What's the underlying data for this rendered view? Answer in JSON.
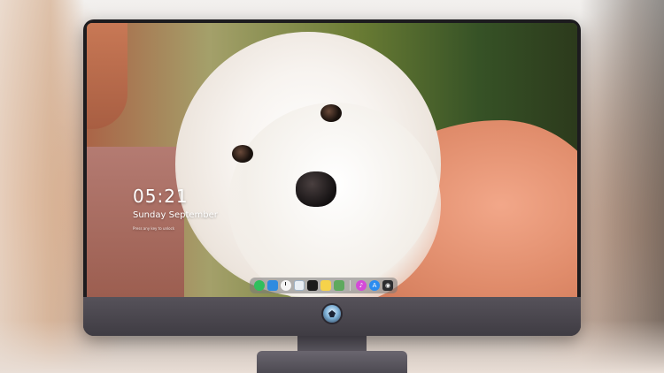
{
  "lock_screen": {
    "time": "05:21",
    "date": "Sunday September",
    "subline": "Press any key to unlock"
  },
  "dock": {
    "apps": [
      {
        "name": "finder",
        "icon": "green-circle-icon",
        "color": "#2fbf5d"
      },
      {
        "name": "files",
        "icon": "blue-folder-icon",
        "color": "#2e8be0"
      },
      {
        "name": "clock",
        "icon": "clock-icon",
        "color": "#f4f4f4"
      },
      {
        "name": "mail",
        "icon": "mail-icon",
        "color": "#e9eef3"
      },
      {
        "name": "video",
        "icon": "clapperboard-icon",
        "color": "#1b1b1b"
      },
      {
        "name": "notes",
        "icon": "notes-icon",
        "color": "#f6d24a"
      },
      {
        "name": "photos",
        "icon": "photos-icon",
        "color": "#5ea95e"
      },
      {
        "name": "music",
        "icon": "music-icon",
        "color": "#d44ad8"
      },
      {
        "name": "app-store",
        "icon": "app-store-icon",
        "color": "#2b8cf0"
      },
      {
        "name": "camera",
        "icon": "camera-icon",
        "color": "#2d2d2f"
      }
    ]
  },
  "colors": {
    "monitor_chin": "#4a474f",
    "dock_background": "#787878"
  }
}
